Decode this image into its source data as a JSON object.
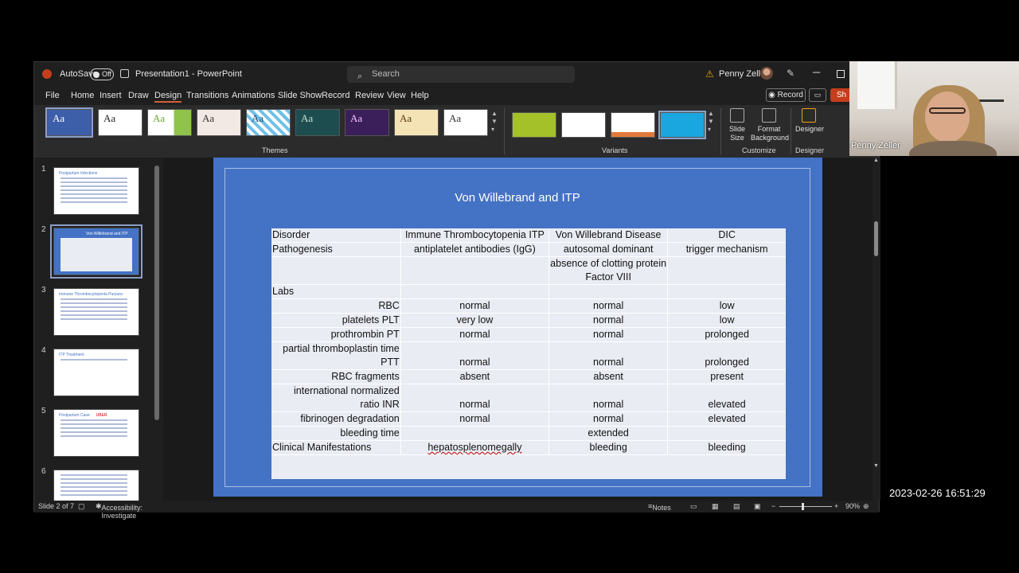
{
  "titlebar": {
    "autosave": "AutoSave",
    "autosave_state": "Off",
    "doc_title": "Presentation1  -  PowerPoint",
    "search_placeholder": "Search",
    "user": "Penny Zeller"
  },
  "menu": [
    "File",
    "Home",
    "Insert",
    "Draw",
    "Design",
    "Transitions",
    "Animations",
    "Slide Show",
    "Record",
    "Review",
    "View",
    "Help"
  ],
  "menu_active": "Design",
  "buttons": {
    "record": "Record",
    "share": "Sh"
  },
  "ribbon": {
    "theme_sample": "Aa",
    "themes_label": "Themes",
    "variants_label": "Variants",
    "customize_label": "Customize",
    "designer_group_label": "Designer",
    "slide_size": "Slide Size",
    "format_background": "Format Background",
    "designer_button": "Designer"
  },
  "thumbnails": [
    {
      "num": "1",
      "title": "Postpartum Infections"
    },
    {
      "num": "2",
      "title": "Von Willebrand and ITP"
    },
    {
      "num": "3",
      "title": "Immune Thrombocytopenia Purpura"
    },
    {
      "num": "4",
      "title": "ITP Treatment"
    },
    {
      "num": "5",
      "title": "Postpartum Case",
      "extra": "UBER"
    },
    {
      "num": "6",
      "title": ""
    }
  ],
  "slide": {
    "title": "Von Willebrand and ITP",
    "header": [
      "Disorder",
      "Immune Thrombocytopenia ITP",
      "Von Willebrand Disease",
      "DIC"
    ],
    "pathogenesis": [
      "Pathogenesis",
      "antiplatelet antibodies (IgG)",
      "autosomal dominant",
      "trigger mechanism"
    ],
    "pathogenesis2": [
      "",
      "",
      "absence of clotting protein Factor VIII",
      ""
    ],
    "labs": "Labs",
    "rows": [
      [
        "RBC",
        "normal",
        "normal",
        "low"
      ],
      [
        "platelets  PLT",
        "very low",
        "normal",
        "low"
      ],
      [
        "prothrombin PT",
        "normal",
        "normal",
        "prolonged"
      ],
      [
        "partial thromboplastin time PTT",
        "normal",
        "normal",
        "prolonged"
      ],
      [
        "RBC fragments",
        "absent",
        "absent",
        "present"
      ],
      [
        "international normalized ratio INR",
        "normal",
        "normal",
        "elevated"
      ],
      [
        "fibrinogen degradation",
        "normal",
        "normal",
        "elevated"
      ],
      [
        "bleeding time",
        "",
        "extended",
        ""
      ],
      [
        "Clinical Manifestations",
        "hepatosplenomegally",
        "bleeding",
        "bleeding"
      ]
    ]
  },
  "status": {
    "slide_of": "Slide 2 of 7",
    "accessibility": "Accessibility: Investigate",
    "notes": "Notes",
    "zoom": "90%"
  },
  "webcam": {
    "name": "Penny Zeller"
  },
  "timestamp": "2023-02-26  16:51:29",
  "colors": {
    "slide_bg": "#4472c4",
    "table_bg": "#e9ecf3",
    "accent": "#c43e1c"
  }
}
